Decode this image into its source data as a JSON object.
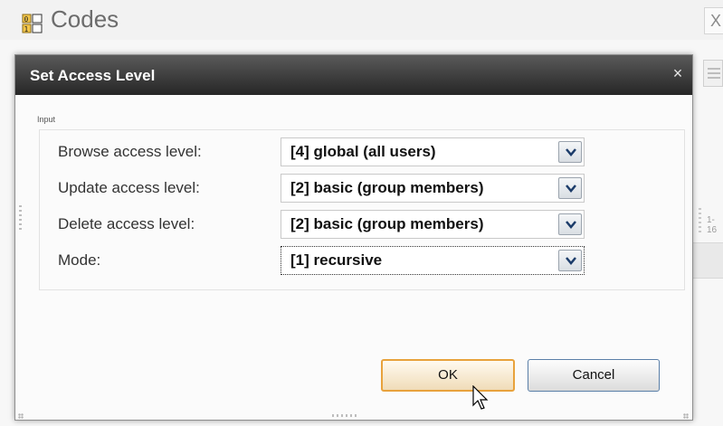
{
  "background_window": {
    "title": "Codes",
    "close_label": "X",
    "range_text": "1-16"
  },
  "dialog": {
    "title": "Set Access Level",
    "close_label": "×",
    "fieldset_legend": "Input",
    "fields": [
      {
        "label": "Browse access level:",
        "value": "[4] global (all users)"
      },
      {
        "label": "Update access level:",
        "value": "[2] basic (group members)"
      },
      {
        "label": "Delete access level:",
        "value": "[2] basic (group members)"
      },
      {
        "label": "Mode:",
        "value": "[1] recursive"
      }
    ],
    "ok_label": "OK",
    "cancel_label": "Cancel"
  },
  "colors": {
    "titlebar": "#262626",
    "ok_border": "#e8a23c",
    "cancel_border": "#5a7fa8"
  }
}
